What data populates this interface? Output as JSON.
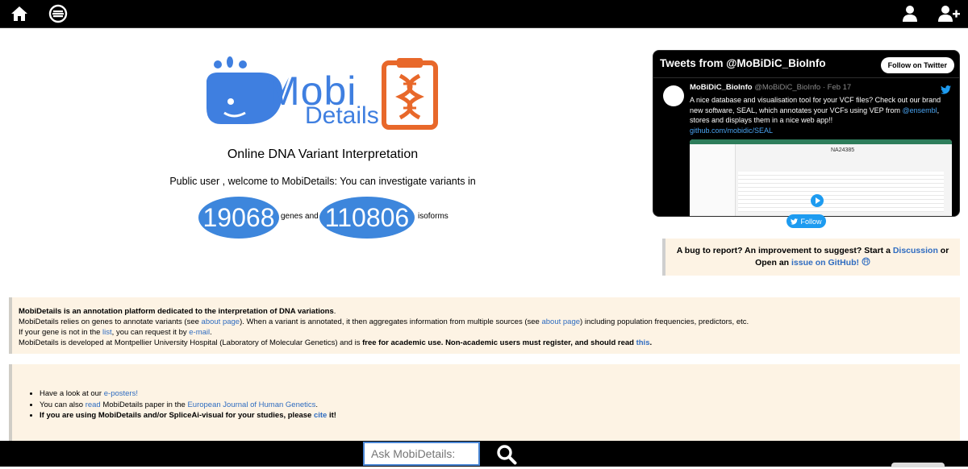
{
  "nav": {
    "home_icon": "home-icon",
    "variant_icon": "circle-menu-icon",
    "user_icon": "user-icon",
    "add_user_icon": "add-user-icon"
  },
  "logo": {
    "line1": "Mobi",
    "line2": "Details"
  },
  "subtitle": "Online DNA Variant Interpretation",
  "welcome": "Public user , welcome to MobiDetails: You can investigate variants in",
  "counts": {
    "genes_value": "19068",
    "genes_label": "genes and",
    "isoforms_value": "110806",
    "isoforms_label": "isoforms"
  },
  "twitter": {
    "title": "Tweets from @MoBiDiC_BioInfo",
    "follow_button": "Follow on Twitter",
    "author": "MoBiDiC_BioInfo",
    "handle_date": "@MoBiDiC_BioInfo · Feb 17",
    "text_part1": "A nice database and visualisation tool for your VCF files? Check out our brand new software, SEAL, which annotates your VCFs using VEP from ",
    "mention": "@ensembl",
    "text_part2": ", stores and displays them in a nice web app!!",
    "link": "github.com/mobidic/SEAL",
    "media_title": "NA24385",
    "follow_pill": "Follow"
  },
  "bug": {
    "text1": "A bug to report? An improvement to suggest? Start a ",
    "discussion": "Discussion",
    "text2": " or",
    "text3": "Open an ",
    "issue": "issue on GitHub!"
  },
  "panel1": {
    "line1": "MobiDetails is an annotation platform dedicated to the interpretation of DNA variations",
    "line1_end": ".",
    "line2_a": "MobiDetails relies on genes to annotate variants (see ",
    "line2_link1": "about page",
    "line2_b": "). When a variant is annotated, it then aggregates information from multiple sources (see ",
    "line2_link2": "about page",
    "line2_c": ") including population frequencies, predictors, etc.",
    "line3_a": "If your gene is not in the ",
    "line3_link1": "list",
    "line3_b": ", you can request it by ",
    "line3_link2": "e-mail",
    "line3_c": ".",
    "line4_a": "MobiDetails is developed at Montpellier University Hospital (Laboratory of Molecular Genetics) and is ",
    "line4_bold": "free for academic use. Non-academic users must register, and should read ",
    "line4_link": "this",
    "line4_end": "."
  },
  "panel2": {
    "item1_a": "Have a look at our ",
    "item1_link": "e-posters!",
    "item2_a": "You can also ",
    "item2_link1": "read",
    "item2_b": " MobiDetails paper in the ",
    "item2_link2": "European Journal of Human Genetics",
    "item2_c": ".",
    "item3_a": "If you are using MobiDetails and/or SpliceAi-visual for your studies, please ",
    "item3_link": "cite",
    "item3_b": " it!"
  },
  "search": {
    "placeholder": "Ask MobiDetails:",
    "button_icon": "search-icon"
  },
  "colors": {
    "accent_blue": "#3d86dc",
    "panel_bg": "#fdf3e4",
    "logo_orange": "#e8682a"
  }
}
